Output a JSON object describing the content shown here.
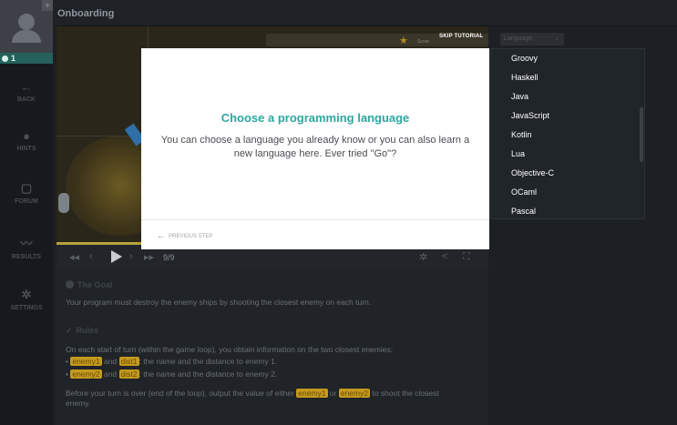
{
  "header": {
    "title": "Onboarding"
  },
  "user": {
    "level": "1"
  },
  "sidebar": {
    "items": [
      {
        "label": "BACK",
        "icon": "back-arrow-icon"
      },
      {
        "label": "HINTS",
        "icon": "lightbulb-icon"
      },
      {
        "label": "FORUM",
        "icon": "forum-icon"
      },
      {
        "label": "RESULTS",
        "icon": "results-chart-icon"
      },
      {
        "label": "SETTINGS",
        "icon": "gear-icon"
      }
    ]
  },
  "viewport": {
    "score_label": "Score",
    "skip_label": "SKIP TUTORIAL"
  },
  "controls": {
    "frame_counter": "9/9"
  },
  "statement": {
    "goal_title": "The Goal",
    "goal_text": "Your program must destroy the enemy ships by shooting the closest enemy on each turn.",
    "rules_title": "Rules",
    "rules_intro": "On each start of turn (within the game loop), you obtain information on the two closest enemies:",
    "bullet1": {
      "var_a": "enemy1",
      "joiner": "and",
      "var_b": "dist1",
      "text": ": the name and the distance to enemy 1."
    },
    "bullet2": {
      "var_a": "enemy2",
      "joiner": "and",
      "var_b": "dist2",
      "text": ": the name and the distance to enemy 2."
    },
    "closing": {
      "part1": "Before your turn is over (end of the loop), output the value of either",
      "var_a": "enemy1",
      "joiner": "or",
      "var_b": "enemy2",
      "part2": "to shoot the closest",
      "part3": "enemy."
    }
  },
  "language": {
    "select_label": "Language",
    "options": [
      "Groovy",
      "Haskell",
      "Java",
      "JavaScript",
      "Kotlin",
      "Lua",
      "Objective-C",
      "OCaml",
      "Pascal"
    ]
  },
  "modal": {
    "title": "Choose a programming language",
    "body": "You can choose a language you already know or you can also learn a new language here. Ever tried \"Go\"?",
    "prev_label": "PREVIOUS STEP"
  },
  "colors": {
    "accent": "#2ba7a1",
    "variable": "#c49a1e",
    "sidebar": "#16191d",
    "level_bg": "#24615a"
  }
}
